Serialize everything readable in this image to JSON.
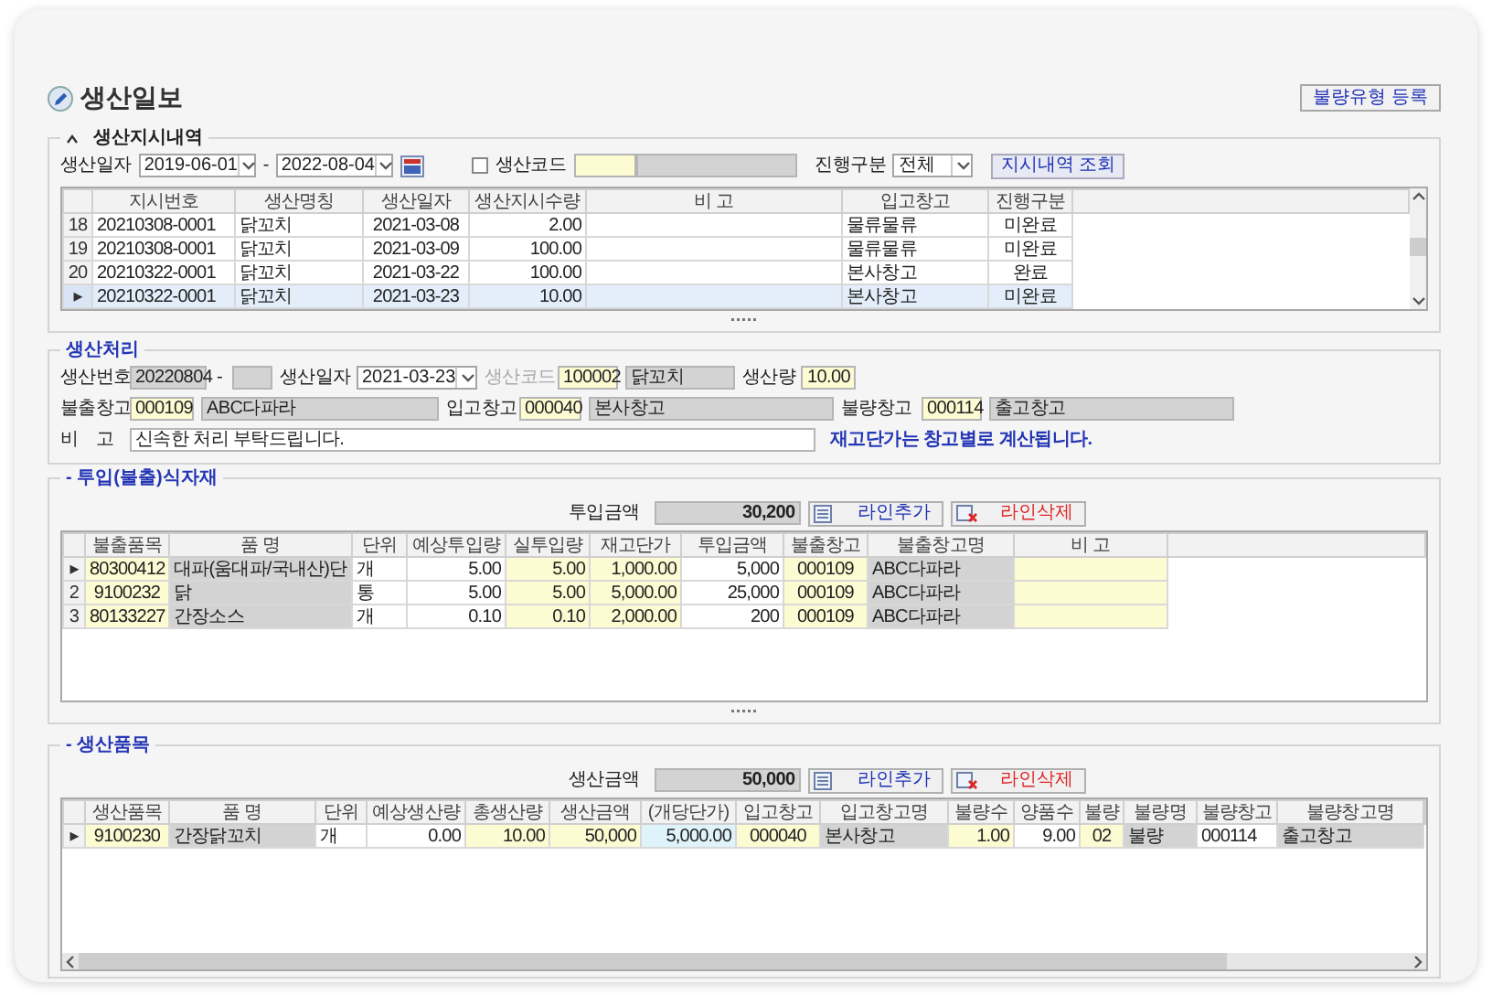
{
  "title": "생산일보",
  "register_button": "불량유형 등록",
  "orders": {
    "legend": "생산지시내역",
    "collapsible": true,
    "filter": {
      "date_label": "생산일자",
      "date_from": "2019-06-01",
      "date_separator": "-",
      "date_to": "2022-08-04",
      "code_label": "생산코드",
      "code_checked": false,
      "status_label": "진행구분",
      "status_value": "전체",
      "search_button": "지시내역 조회"
    },
    "grid": {
      "columns": [
        {
          "label": "지시번호"
        },
        {
          "label": "생산명칭"
        },
        {
          "label": "생산일자"
        },
        {
          "label": "생산지시수량"
        },
        {
          "label": "비 고"
        },
        {
          "label": "입고창고"
        },
        {
          "label": "진행구분"
        }
      ],
      "rows": [
        {
          "marker": "18",
          "selected": false,
          "cells": [
            "20210308-0001",
            "닭꼬치",
            "2021-03-08",
            "2.00",
            null,
            "물류물류",
            "미완료"
          ]
        },
        {
          "marker": "19",
          "selected": false,
          "cells": [
            "20210308-0001",
            "닭꼬치",
            "2021-03-09",
            "100.00",
            null,
            "물류물류",
            "미완료"
          ]
        },
        {
          "marker": "20",
          "selected": false,
          "cells": [
            "20210322-0001",
            "닭꼬치",
            "2021-03-22",
            "100.00",
            null,
            "본사창고",
            "완료"
          ]
        },
        {
          "marker": "▸",
          "selected": true,
          "cells": [
            "20210322-0001",
            "닭꼬치",
            "2021-03-23",
            "10.00",
            null,
            "본사창고",
            "미완료"
          ]
        }
      ]
    }
  },
  "processing": {
    "legend": "생산처리",
    "rows": [
      {
        "items": [
          {
            "kind": "label",
            "text": "생산번호",
            "disabled": false
          },
          {
            "kind": "readonly",
            "value": "20220804"
          },
          {
            "kind": "dash",
            "text": "-"
          },
          {
            "kind": "readonly"
          },
          {
            "kind": "label",
            "text": "생산일자",
            "disabled": false
          },
          {
            "kind": "select",
            "value": "2021-03-23"
          },
          {
            "kind": "label",
            "text": "생산코드",
            "disabled": true
          },
          {
            "kind": "input",
            "value": "100002"
          },
          {
            "kind": "readonly",
            "value": "닭꼬치"
          },
          {
            "kind": "label",
            "text": "생산량",
            "disabled": false
          },
          {
            "kind": "number",
            "value": "10.00"
          }
        ]
      },
      {
        "items": [
          {
            "kind": "label",
            "text": "불출창고",
            "disabled": false
          },
          {
            "kind": "input",
            "value": "000109"
          },
          {
            "kind": "readonly",
            "value": "ABC다파라"
          },
          {
            "kind": "label",
            "text": "입고창고",
            "disabled": false
          },
          {
            "kind": "input",
            "value": "000040"
          },
          {
            "kind": "readonly",
            "value": "본사창고"
          },
          {
            "kind": "label",
            "text": "불량창고",
            "disabled": false
          },
          {
            "kind": "input",
            "value": "000114"
          },
          {
            "kind": "readonly",
            "value": "출고창고"
          }
        ]
      },
      {
        "items": [
          {
            "kind": "label",
            "text": "비    고",
            "disabled": false
          },
          {
            "kind": "plain",
            "value": "신속한 처리 부탁드립니다."
          },
          {
            "kind": "note",
            "text": "재고단가는 창고별로 계산됩니다."
          }
        ]
      }
    ]
  },
  "materials": {
    "legend": "- 투입(불출)식자재",
    "total_label": "투입금액",
    "total_value": "30,200",
    "add_button": "라인추가",
    "delete_button": "라인삭제",
    "grid": {
      "columns": [
        {
          "label": "불출품목",
          "kind": "input"
        },
        {
          "label": "품 명",
          "kind": "readonly"
        },
        {
          "label": "단위",
          "kind": "plain"
        },
        {
          "label": "예상투입량",
          "kind": "plain"
        },
        {
          "label": "실투입량",
          "kind": "input"
        },
        {
          "label": "재고단가",
          "kind": "input"
        },
        {
          "label": "투입금액",
          "kind": "plain"
        },
        {
          "label": "불출창고",
          "kind": "input"
        },
        {
          "label": "불출창고명",
          "kind": "readonly"
        },
        {
          "label": "비 고",
          "kind": "input"
        }
      ],
      "rows": [
        {
          "marker": "▸",
          "cells": [
            "80300412",
            "대파(움대파/국내산)단",
            "개",
            "5.00",
            "5.00",
            "1,000.00",
            "5,000",
            "000109",
            "ABC다파라",
            null
          ]
        },
        {
          "marker": "2",
          "cells": [
            "9100232",
            "닭",
            "통",
            "5.00",
            "5.00",
            "5,000.00",
            "25,000",
            "000109",
            "ABC다파라",
            null
          ]
        },
        {
          "marker": "3",
          "cells": [
            "80133227",
            "간장소스",
            "개",
            "0.10",
            "0.10",
            "2,000.00",
            "200",
            "000109",
            "ABC다파라",
            null
          ]
        }
      ]
    }
  },
  "products": {
    "legend": "- 생산품목",
    "total_label": "생산금액",
    "total_value": "50,000",
    "add_button": "라인추가",
    "delete_button": "라인삭제",
    "grid": {
      "columns": [
        {
          "label": "생산품목",
          "kind": "input"
        },
        {
          "label": "품 명",
          "kind": "readonly"
        },
        {
          "label": "단위",
          "kind": "plain"
        },
        {
          "label": "예상생산량",
          "kind": "plain"
        },
        {
          "label": "총생산량",
          "kind": "input"
        },
        {
          "label": "생산금액",
          "kind": "input"
        },
        {
          "label": "(개당단가)",
          "kind": "computed"
        },
        {
          "label": "입고창고",
          "kind": "input"
        },
        {
          "label": "입고창고명",
          "kind": "readonly"
        },
        {
          "label": "불량수",
          "kind": "input"
        },
        {
          "label": "양품수",
          "kind": "plain"
        },
        {
          "label": "불량",
          "kind": "input"
        },
        {
          "label": "불량명",
          "kind": "readonly"
        },
        {
          "label": "불량창고",
          "kind": "plain"
        },
        {
          "label": "불량창고명",
          "kind": "readonly"
        }
      ],
      "rows": [
        {
          "marker": "▸",
          "cells": [
            "9100230",
            "간장닭꼬치",
            "개",
            "0.00",
            "10.00",
            "50,000",
            "5,000.00",
            "000040",
            "본사창고",
            "1.00",
            "9.00",
            "02",
            "불량",
            "000114",
            "출고창고"
          ]
        }
      ]
    }
  }
}
